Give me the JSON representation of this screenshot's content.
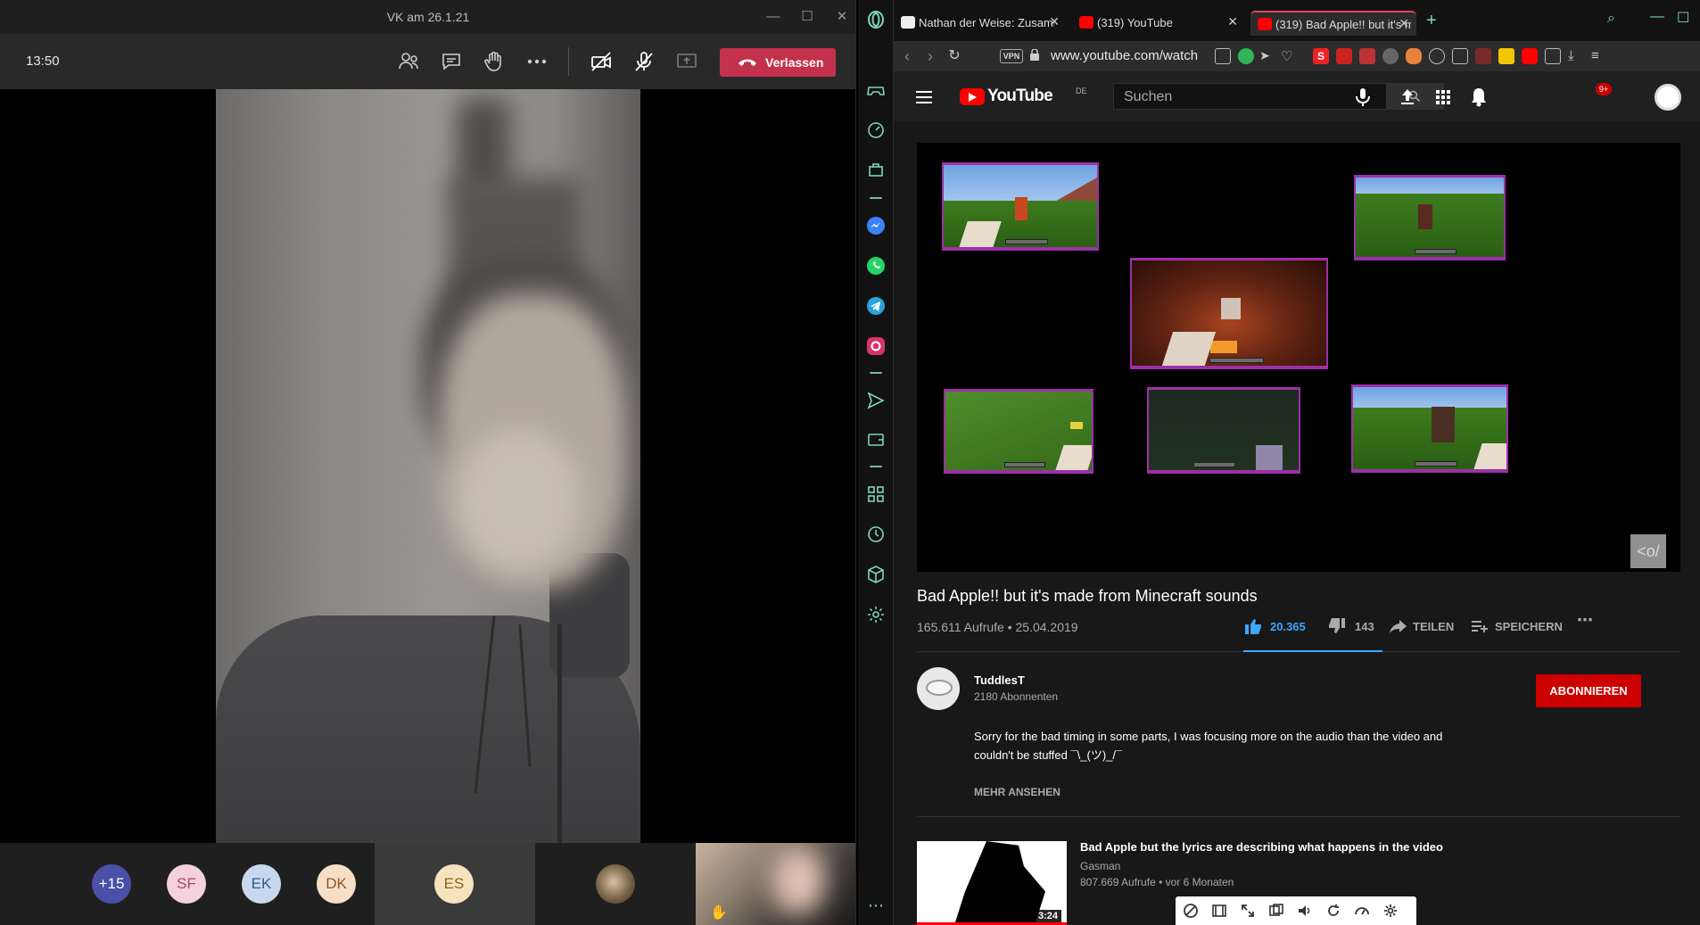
{
  "teams": {
    "window_title": "VK am 26.1.21",
    "clock": "13:50",
    "leave_label": "Verlassen",
    "participants": [
      {
        "initials": "+15",
        "color": "#4b4fa7",
        "text_color": "#ffffff"
      },
      {
        "initials": "SF",
        "color": "#f3d2dc",
        "text_color": "#b0446a"
      },
      {
        "initials": "EK",
        "color": "#c8d9ef",
        "text_color": "#2f5b8f"
      },
      {
        "initials": "DK",
        "color": "#f7dec6",
        "text_color": "#8b5a2b"
      },
      {
        "initials": "ES",
        "color": "#f6e3bd",
        "text_color": "#8a6420"
      }
    ],
    "accent_color": "#c4314b"
  },
  "browser": {
    "tabs": [
      {
        "title": "Nathan der Weise: Zusamm",
        "active": false
      },
      {
        "title": "(319) YouTube",
        "active": false
      },
      {
        "title": "(319) Bad Apple!! but it's m",
        "active": true
      }
    ],
    "vpn_label": "VPN",
    "url": "www.youtube.com/watch"
  },
  "youtube": {
    "logo_text": "YouTube",
    "country_code": "DE",
    "search_placeholder": "Suchen",
    "notification_count": "9+",
    "video": {
      "title": "Bad Apple!! but it's made from Minecraft sounds",
      "views_date": "165.611 Aufrufe • 25.04.2019",
      "likes": "20.365",
      "dislikes": "143",
      "share_label": "TEILEN",
      "save_label": "SPEICHERN",
      "player_overlay": "<o/"
    },
    "channel": {
      "name": "TuddlesT",
      "subscribers": "2180 Abonnenten",
      "subscribe_label": "ABONNIEREN",
      "description_line1": "Sorry for the bad timing in some parts, I was focusing more on the audio than the video and",
      "description_line2": "couldn't be stuffed ¯\\_(ツ)_/¯",
      "more_label": "MEHR ANSEHEN"
    },
    "recommendation": {
      "title": "Bad Apple but the lyrics are describing what happens in the video",
      "channel": "Gasman",
      "meta": "807.669 Aufrufe • vor 6 Monaten",
      "duration": "3:24"
    },
    "like_color": "#3ea6ff",
    "brand_color": "#ff0000"
  }
}
